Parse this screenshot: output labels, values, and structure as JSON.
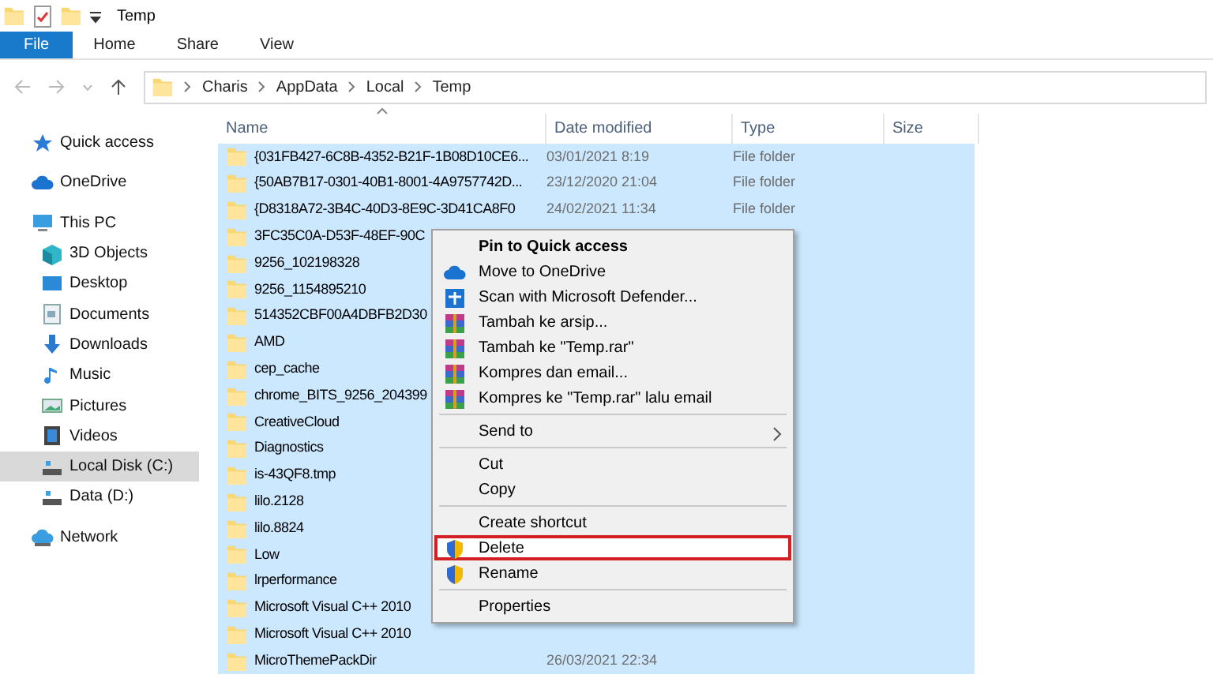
{
  "window": {
    "title": "Temp"
  },
  "ribbon_tabs": [
    {
      "label": "File",
      "selected": true
    },
    {
      "label": "Home",
      "selected": false
    },
    {
      "label": "Share",
      "selected": false
    },
    {
      "label": "View",
      "selected": false
    }
  ],
  "address_bar": {
    "path": [
      "Charis",
      "AppData",
      "Local",
      "Temp"
    ]
  },
  "sidebar": {
    "items": [
      {
        "label": "Quick access",
        "kind": "star",
        "selected": false
      },
      {
        "label": "OneDrive",
        "kind": "cloud",
        "selected": false
      },
      {
        "label": "This PC",
        "kind": "pc",
        "selected": false,
        "children": [
          {
            "label": "3D Objects",
            "kind": "cube",
            "selected": false
          },
          {
            "label": "Desktop",
            "kind": "desktop",
            "selected": false
          },
          {
            "label": "Documents",
            "kind": "document",
            "selected": false
          },
          {
            "label": "Downloads",
            "kind": "download",
            "selected": false
          },
          {
            "label": "Music",
            "kind": "music",
            "selected": false
          },
          {
            "label": "Pictures",
            "kind": "picture",
            "selected": false
          },
          {
            "label": "Videos",
            "kind": "video",
            "selected": false
          },
          {
            "label": "Local Disk (C:)",
            "kind": "drive",
            "selected": true
          },
          {
            "label": "Data (D:)",
            "kind": "drive",
            "selected": false
          }
        ]
      },
      {
        "label": "Network",
        "kind": "network",
        "selected": false
      }
    ]
  },
  "table": {
    "columns": [
      "Name",
      "Date modified",
      "Type",
      "Size"
    ],
    "rows": [
      {
        "name": "{031FB427-6C8B-4352-B21F-1B08D10CE6...",
        "date": "03/01/2021 8:19",
        "type": "File folder",
        "selected": true
      },
      {
        "name": "{50AB7B17-0301-40B1-8001-4A9757742D...",
        "date": "23/12/2020 21:04",
        "type": "File folder",
        "selected": true
      },
      {
        "name": "{D8318A72-3B4C-40D3-8E9C-3D41CA8F0",
        "date": "24/02/2021 11:34",
        "type": "File folder",
        "selected": true
      },
      {
        "name": "3FC35C0A-D53F-48EF-90C",
        "selected": true
      },
      {
        "name": "9256_102198328",
        "selected": true
      },
      {
        "name": "9256_1154895210",
        "selected": true
      },
      {
        "name": "514352CBF00A4DBFB2D30",
        "selected": true
      },
      {
        "name": "AMD",
        "selected": true
      },
      {
        "name": "cep_cache",
        "selected": true
      },
      {
        "name": "chrome_BITS_9256_204399",
        "selected": true
      },
      {
        "name": "CreativeCloud",
        "selected": true
      },
      {
        "name": "Diagnostics",
        "selected": true
      },
      {
        "name": "is-43QF8.tmp",
        "selected": true
      },
      {
        "name": "lilo.2128",
        "selected": true
      },
      {
        "name": "lilo.8824",
        "selected": true
      },
      {
        "name": "Low",
        "selected": true
      },
      {
        "name": "lrperformance",
        "selected": true
      },
      {
        "name": "Microsoft Visual C++ 2010",
        "selected": true
      },
      {
        "name": "Microsoft Visual C++ 2010",
        "selected": true
      },
      {
        "name": "MicroThemePackDir",
        "date": "26/03/2021 22:34",
        "selected": true
      }
    ]
  },
  "context_menu": {
    "groups": [
      [
        {
          "label": "Pin to Quick access",
          "kind": "bold",
          "highlighted": false
        },
        {
          "label": "Move to OneDrive",
          "kind": "cloud",
          "highlighted": false
        },
        {
          "label": "Scan with Microsoft Defender...",
          "kind": "defender",
          "highlighted": false
        },
        {
          "label": "Tambah ke arsip...",
          "kind": "archive",
          "highlighted": false
        },
        {
          "label": "Tambah ke \"Temp.rar\"",
          "kind": "archive",
          "highlighted": false
        },
        {
          "label": "Kompres dan email...",
          "kind": "archive",
          "highlighted": false
        },
        {
          "label": "Kompres ke \"Temp.rar\" lalu email",
          "kind": "archive",
          "highlighted": false
        }
      ],
      [
        {
          "label": "Send to",
          "kind": "submenu",
          "highlighted": false
        }
      ],
      [
        {
          "label": "Cut",
          "kind": "plain",
          "highlighted": false
        },
        {
          "label": "Copy",
          "kind": "plain",
          "highlighted": false
        }
      ],
      [
        {
          "label": "Create shortcut",
          "kind": "plain",
          "highlighted": false
        },
        {
          "label": "Delete",
          "kind": "admin",
          "highlighted": true
        },
        {
          "label": "Rename",
          "kind": "admin",
          "highlighted": false
        }
      ],
      [
        {
          "label": "Properties",
          "kind": "plain",
          "highlighted": false
        }
      ]
    ]
  }
}
